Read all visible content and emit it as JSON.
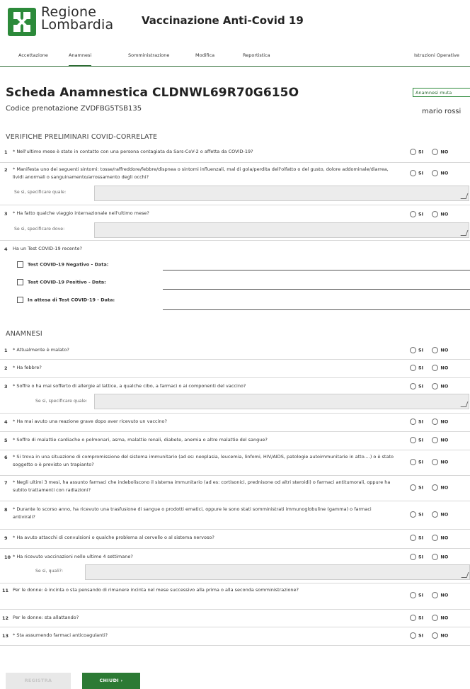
{
  "header": {
    "logo_line1": "Regione",
    "logo_line2": "Lombardia",
    "app_title": "Vaccinazione Anti-Covid 19",
    "brand_color": "#2c8a3a"
  },
  "tabs": [
    {
      "label": "Accettazione",
      "active": false
    },
    {
      "label": "Anamnesi",
      "active": true
    },
    {
      "label": "Somministrazione",
      "active": false
    },
    {
      "label": "Modifica",
      "active": false
    },
    {
      "label": "Reportistica",
      "active": false
    },
    {
      "label": "Istruzioni Operative",
      "active": false
    }
  ],
  "page": {
    "title": "Scheda Anamnestica CLDNWL69R70G615O",
    "codice": "Codice prenotazione ZVDFBG5TSB135",
    "badge": "Anamnesi muta",
    "user": "mario rossi"
  },
  "radio_labels": {
    "si": "SI",
    "no": "NO"
  },
  "verifiche": {
    "title": "VERIFICHE PRELIMINARI COVID-CORRELATE",
    "q1": {
      "num": "1",
      "text": "* Nell'ultimo mese è stato in contatto con una persona contagiata da Sars-CoV-2 o affetta da COVID-19?"
    },
    "q2": {
      "num": "2",
      "text": "* Manifesta uno dei seguenti sintomi: tosse/raffreddore/febbre/dispnea o sintomi influenzali, mal di gola/perdita dell'olfatto o del gusto, dolore addominale/diarrea, lividi anormali o sanguinamento/arrossamento degli occhi?",
      "sub_label": "Se si, specificare quale:"
    },
    "q3": {
      "num": "3",
      "text": "* Ha fatto qualche viaggio internazionale nell'ultimo mese?",
      "sub_label": "Se si, specificare dove:"
    },
    "q4": {
      "num": "4",
      "text": "Ha un Test COVID-19 recente?",
      "options": [
        "Test COVID-19 Negativo - Data:",
        "Test COVID-19 Positivo - Data:",
        "In attesa di Test COVID-19 - Data:"
      ]
    }
  },
  "anamnesi": {
    "title": "ANAMNESI",
    "q1": {
      "num": "1",
      "text": "* Attualmente è malato?"
    },
    "q2": {
      "num": "2",
      "text": "* Ha febbre?"
    },
    "q3": {
      "num": "3",
      "text": "* Soffre o ha mai sofferto di allergie al lattice, a qualche cibo, a farmaci o ai componenti del vaccino?",
      "sub_label": "Se si, specificare quale:"
    },
    "q4": {
      "num": "4",
      "text": "* Ha mai avuto una reazione grave dopo aver ricevuto un vaccino?"
    },
    "q5": {
      "num": "5",
      "text": "* Soffre di malattie cardiache o polmonari, asma, malattie renali, diabete, anemia o altre malattie del sangue?"
    },
    "q6": {
      "num": "6",
      "text": "* Si trova in una situazione di compromissione del sistema immunitario (ad es: neoplasia, leucemia, linfomi, HIV/AIDS, patologie autoimmunitarie in atto....) o è stato soggetto o è previsto un trapianto?"
    },
    "q7": {
      "num": "7",
      "text": "* Negli ultimi 3 mesi, ha assunto farmaci che indeboliscono il sistema immunitario (ad es: cortisonici, prednisone od altri steroidi) o farmaci antitumorali, oppure ha subito trattamenti con radiazioni?"
    },
    "q8": {
      "num": "8",
      "text": "* Durante lo scorso anno, ha ricevuto una trasfusione di sangue o prodotti ematici, oppure le sono stati somministrati immunoglobuline (gamma) o farmaci antivirali?"
    },
    "q9": {
      "num": "9",
      "text": "* Ha avuto attacchi di convulsioni o qualche problema al cervello o al sistema nervoso?"
    },
    "q10": {
      "num": "10",
      "text": "* Ha ricevuto vaccinazioni nelle ultime 4 settimane?",
      "sub_label": "Se si, quali?:"
    },
    "q11": {
      "num": "11",
      "text": "Per le donne: è incinta o sta pensando di rimanere incinta nel mese successivo alla prima o alla seconda somministrazione?"
    },
    "q12": {
      "num": "12",
      "text": "Per le donne: sta allattando?"
    },
    "q13": {
      "num": "13",
      "text": "* Sta assumendo farmaci anticoagulanti?"
    }
  },
  "buttons": {
    "registra": "REGISTRA",
    "chiudi": "CHIUDI ›"
  }
}
